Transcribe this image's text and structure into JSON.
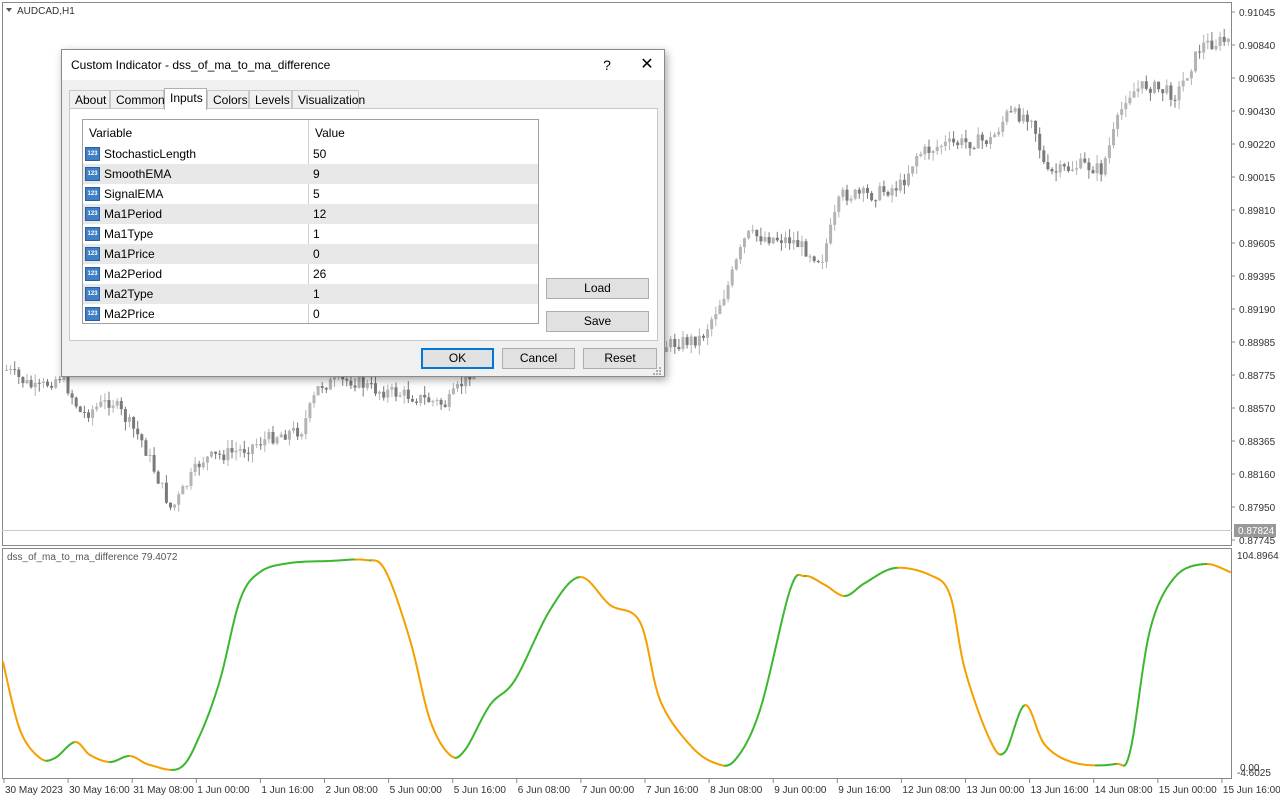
{
  "symbol": "AUDCAD,H1",
  "price_axis": [
    "0.91045",
    "0.90840",
    "0.90635",
    "0.90430",
    "0.90220",
    "0.90015",
    "0.89810",
    "0.89605",
    "0.89395",
    "0.89190",
    "0.88985",
    "0.88775",
    "0.88570",
    "0.88365",
    "0.88160",
    "0.87950",
    "0.87745"
  ],
  "current_price": "0.87824",
  "indicator_label": "dss_of_ma_to_ma_difference 79.4072",
  "indicator_axis": {
    "top": "104.8964",
    "bottom": "-4.6025",
    "bottom_overlay": "0.00"
  },
  "time_axis": [
    "30 May 2023",
    "30 May 16:00",
    "31 May 08:00",
    "1 Jun 00:00",
    "1 Jun 16:00",
    "2 Jun 08:00",
    "5 Jun 00:00",
    "5 Jun 16:00",
    "6 Jun 08:00",
    "7 Jun 00:00",
    "7 Jun 16:00",
    "8 Jun 08:00",
    "9 Jun 00:00",
    "9 Jun 16:00",
    "12 Jun 08:00",
    "13 Jun 00:00",
    "13 Jun 16:00",
    "14 Jun 08:00",
    "15 Jun 00:00",
    "15 Jun 16:00"
  ],
  "colors": {
    "rising": "#3cb830",
    "falling": "#f5a000",
    "candle": "#9a9a9a"
  },
  "dialog": {
    "title": "Custom Indicator - dss_of_ma_to_ma_difference",
    "help": "?",
    "close": "✕",
    "tabs": [
      "About",
      "Common",
      "Inputs",
      "Colors",
      "Levels",
      "Visualization"
    ],
    "active_tab": "Inputs",
    "columns": {
      "variable": "Variable",
      "value": "Value"
    },
    "icon_text": "123",
    "params": [
      {
        "name": "StochasticLength",
        "value": "50"
      },
      {
        "name": "SmoothEMA",
        "value": "9"
      },
      {
        "name": "SignalEMA",
        "value": "5"
      },
      {
        "name": "Ma1Period",
        "value": "12"
      },
      {
        "name": "Ma1Type",
        "value": "1"
      },
      {
        "name": "Ma1Price",
        "value": "0"
      },
      {
        "name": "Ma2Period",
        "value": "26"
      },
      {
        "name": "Ma2Type",
        "value": "1"
      },
      {
        "name": "Ma2Price",
        "value": "0"
      }
    ],
    "buttons": {
      "load": "Load",
      "save": "Save",
      "ok": "OK",
      "cancel": "Cancel",
      "reset": "Reset"
    }
  }
}
